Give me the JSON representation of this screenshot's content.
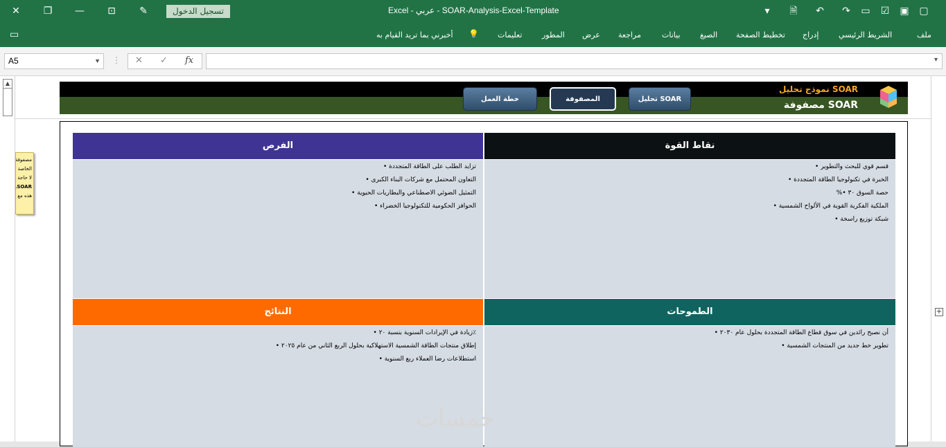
{
  "window": {
    "app_name": "Excel",
    "title": "Excel  -  عربي  -  SOAR-Analysis-Excel-Template",
    "signin_label": "تسجيل الدخول"
  },
  "ribbon": {
    "tabs": [
      "ملف",
      "الشريط الرئيسي",
      "إدراج",
      "تخطيط الصفحة",
      "الصيغ",
      "بيانات",
      "مراجعة",
      "عرض",
      "المطور",
      "تعليمات"
    ],
    "tell_me": "أخبرني بما تريد القيام به"
  },
  "formula_bar": {
    "name_box": "A5",
    "fx_label": "fx",
    "formula": ""
  },
  "header": {
    "title_line1": "نموذج تحليل SOAR",
    "title_line2": "مصفوفة SOAR",
    "nav": [
      {
        "label": "تحليل SOAR",
        "active": false
      },
      {
        "label": "المصفوفة",
        "active": true
      },
      {
        "label": "خطة العمل",
        "active": false
      }
    ]
  },
  "note": {
    "lines": [
      "مصفوفة",
      "الخاصة",
      "لا حاجة",
      "SOAR.",
      "هذه مع"
    ]
  },
  "quadrants": {
    "strengths": {
      "title": "نقاط القوة",
      "color": "#0c1214",
      "items": [
        "قسم قوي للبحث والتطوير •",
        "الخبرة في تكنولوجيا الطاقة المتجددة •",
        "حصة السوق ٣٠ •%",
        "الملكية الفكرية القوية في الألواح الشمسية •",
        "شبكة توزيع راسخة •"
      ]
    },
    "opportunities": {
      "title": "الفرص",
      "color": "#3f3494",
      "items": [
        "تزايد الطلب على الطاقة المتجددة •",
        "التعاون المحتمل مع شركات البناء الكبرى •",
        "التمثيل الضوئي الاصطناعي والبطاريات الحيوية •",
        "الحوافز الحكومية للتكنولوجيا الخضراء •"
      ]
    },
    "aspirations": {
      "title": "الطموحات",
      "color": "#0f6460",
      "items": [
        "أن نصبح رائدين في سوق قطاع الطاقة المتجددة بحلول عام ٢٠٣٠ •",
        "تطوير خط جديد من المنتجات الشمسية •"
      ]
    },
    "results": {
      "title": "النتائج",
      "color": "#ff6a00",
      "items": [
        "٪زيادة في الإيرادات السنوية بنسبة ٢٠ •",
        "إطلاق منتجات الطاقة الشمسية الاستهلاكية بحلول الربع الثاني من عام ٢٠٢٥ •",
        "استطلاعات رضا العملاء ربع السنوية •"
      ]
    }
  },
  "watermark": "خمسات"
}
